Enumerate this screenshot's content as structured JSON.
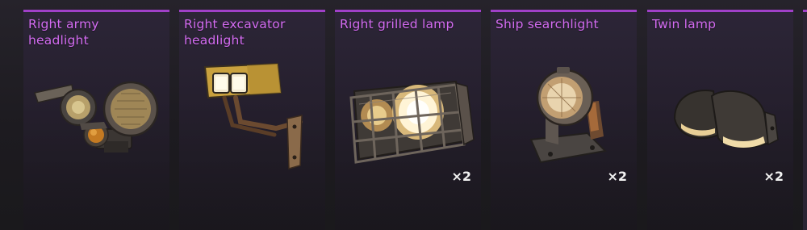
{
  "inventory": {
    "items": [
      {
        "name": "Right army headlight",
        "title": "Right army\nheadlight",
        "quantity": "",
        "icon": "army-headlight-icon"
      },
      {
        "name": "Right excavator headlight",
        "title": "Right excavator\nheadlight",
        "quantity": "",
        "icon": "excavator-headlight-icon"
      },
      {
        "name": "Right grilled lamp",
        "title": "Right grilled lamp",
        "quantity": "×2",
        "icon": "grilled-lamp-icon"
      },
      {
        "name": "Ship searchlight",
        "title": "Ship searchlight",
        "quantity": "×2",
        "icon": "ship-searchlight-icon"
      },
      {
        "name": "Twin lamp",
        "title": "Twin lamp",
        "quantity": "×2",
        "icon": "twin-lamp-icon"
      }
    ]
  },
  "colors": {
    "accent": "#a040c8",
    "title_text": "#d46cf2",
    "quantity_text": "#f2f2f2",
    "card_bg": "#2a2433",
    "page_bg": "#1d1b20"
  }
}
